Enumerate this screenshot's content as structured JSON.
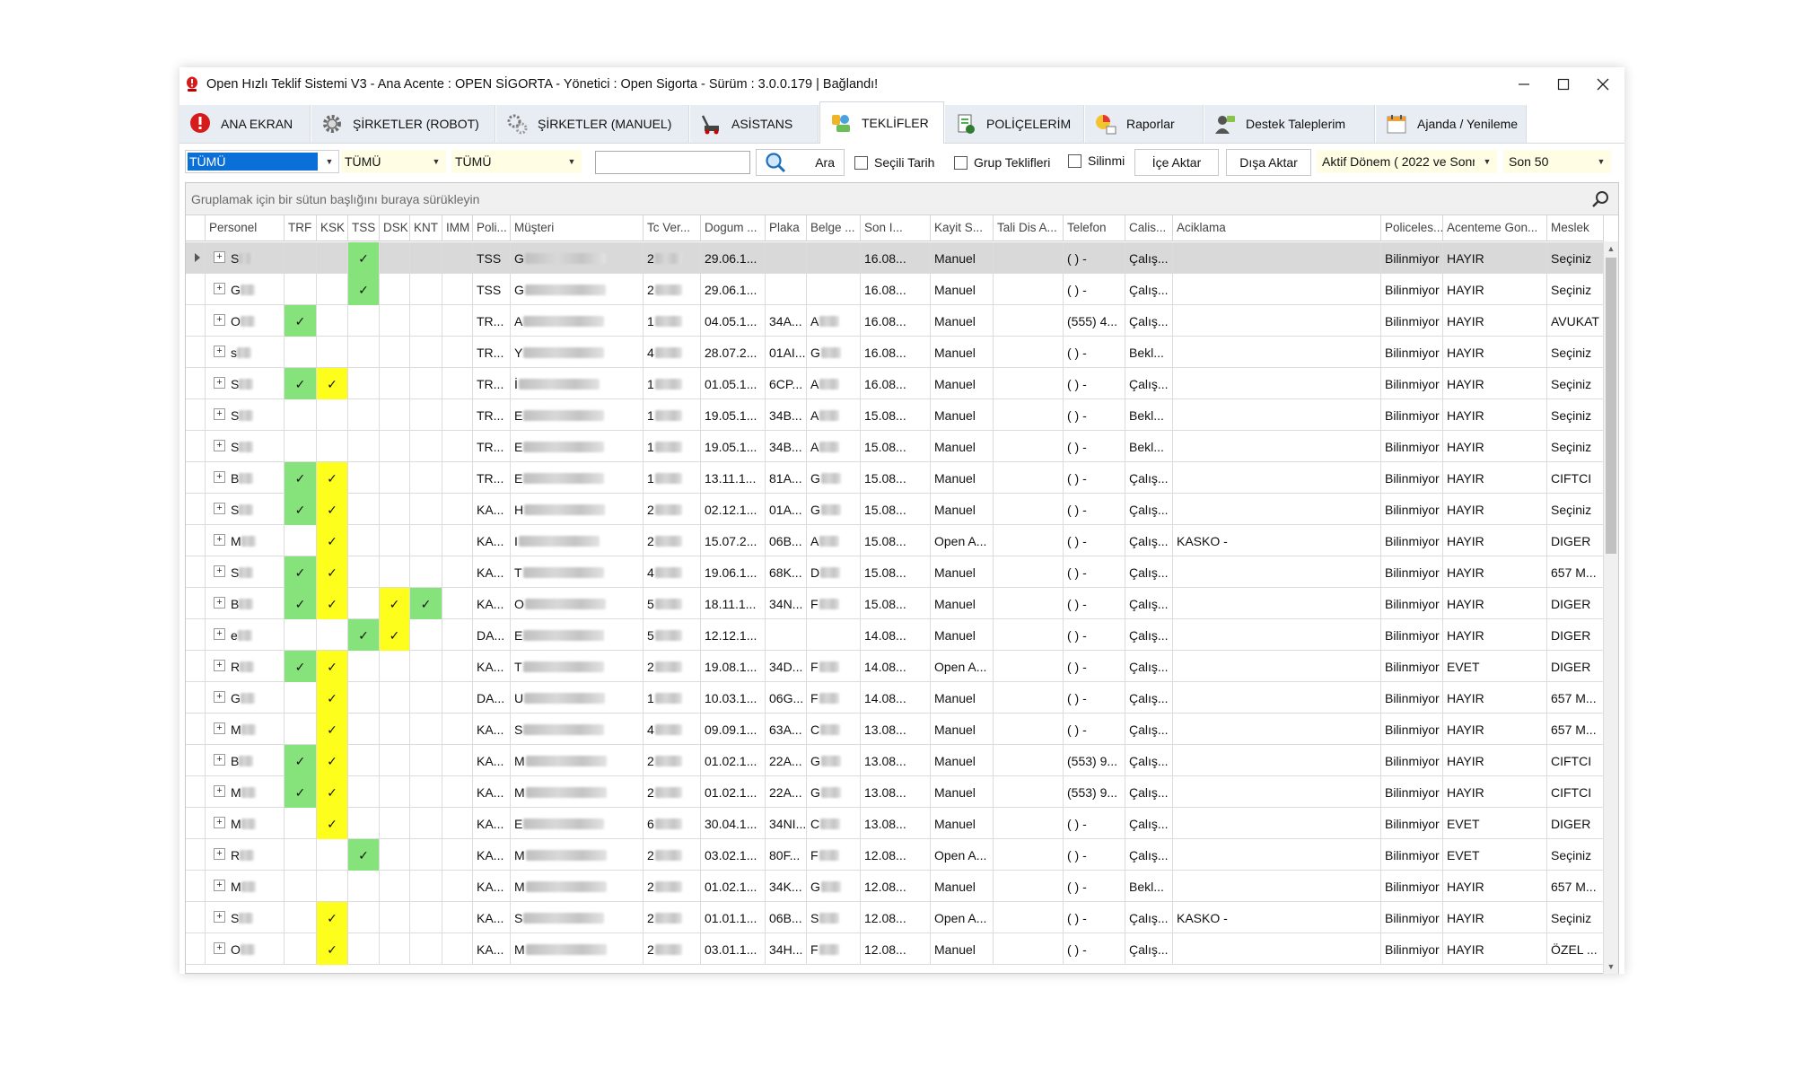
{
  "window": {
    "title": "Open Hızlı Teklif Sistemi V3 - Ana Acente : OPEN SİGORTA - Yönetici : Open Sigorta - Sürüm : 3.0.0.179 | Bağlandı!"
  },
  "tabs": [
    {
      "label": "ANA EKRAN",
      "icon": "home-alert-icon"
    },
    {
      "label": "ŞİRKETLER (ROBOT)",
      "icon": "gear-icon"
    },
    {
      "label": "ŞİRKETLER (MANUEL)",
      "icon": "gears-icon"
    },
    {
      "label": "ASİSTANS",
      "icon": "tow-truck-icon"
    },
    {
      "label": "TEKLİFLER",
      "icon": "offers-icon"
    },
    {
      "label": "POLİÇELERİM",
      "icon": "policy-icon"
    },
    {
      "label": "Raporlar",
      "icon": "reports-icon"
    },
    {
      "label": "Destek Taleplerim",
      "icon": "support-icon"
    },
    {
      "label": "Ajanda / Yenileme",
      "icon": "calendar-icon"
    }
  ],
  "active_tab": "TEKLİFLER",
  "toolbar": {
    "filter1": "TÜMÜ",
    "filter2": "TÜMÜ",
    "filter3": "TÜMÜ",
    "search_value": "",
    "search_button": "Ara",
    "checkbox_secili_tarih": "Seçili Tarih",
    "checkbox_grup_teklifleri": "Grup Teklifleri",
    "checkbox_silinmis": "Silinmi",
    "import_button": "İçe Aktar",
    "export_button": "Dışa Aktar",
    "period": "Aktif Dönem ( 2022 ve Sonr",
    "limit": "Son  50"
  },
  "grid": {
    "group_hint": "Gruplamak için bir sütun başlığını buraya sürükleyin",
    "columns": [
      "Personel",
      "TRF",
      "KSK",
      "TSS",
      "DSK",
      "KNT",
      "IMM",
      "Poli...",
      "Müşteri",
      "Tc Ver...",
      "Dogum ...",
      "Plaka",
      "Belge ...",
      "Son I...",
      "Kayit S...",
      "Tali Dis A...",
      "Telefon",
      "Calis...",
      "Aciklama",
      "Policeles...",
      "Acenteme Gon...",
      "Meslek"
    ],
    "rows": [
      {
        "p": "Sı",
        "trf": "",
        "ksk": "",
        "tss": "g",
        "dsk": "",
        "knt": "",
        "poli": "TSS",
        "m": "G",
        "tc": "2",
        "dog": "29.06.1...",
        "plaka": "",
        "belge": "",
        "son": "16.08...",
        "kayit": "Manuel",
        "tel": "( )  -",
        "calis": "Çalış...",
        "acik": "",
        "pol": "Bilinmiyor",
        "gon": "HAYIR",
        "meslek": "Seçiniz"
      },
      {
        "p": "Gı",
        "trf": "",
        "ksk": "",
        "tss": "g",
        "dsk": "",
        "knt": "",
        "poli": "TSS",
        "m": "G",
        "tc": "2",
        "dog": "29.06.1...",
        "plaka": "",
        "belge": "",
        "son": "16.08...",
        "kayit": "Manuel",
        "tel": "( )  -",
        "calis": "Çalış...",
        "acik": "",
        "pol": "Bilinmiyor",
        "gon": "HAYIR",
        "meslek": "Seçiniz"
      },
      {
        "p": "Oı",
        "trf": "g",
        "ksk": "",
        "tss": "",
        "dsk": "",
        "knt": "",
        "poli": "TR...",
        "m": "A",
        "tc": "1",
        "dog": "04.05.1...",
        "plaka": "34A...",
        "belge": "A",
        "son": "16.08...",
        "kayit": "Manuel",
        "tel": "(555) 4...",
        "calis": "Çalış...",
        "acik": "",
        "pol": "Bilinmiyor",
        "gon": "HAYIR",
        "meslek": "AVUKAT"
      },
      {
        "p": "sı",
        "trf": "",
        "ksk": "",
        "tss": "",
        "dsk": "",
        "knt": "",
        "poli": "TR...",
        "m": "Y",
        "tc": "4",
        "dog": "28.07.2...",
        "plaka": "01AI...",
        "belge": "G",
        "son": "16.08...",
        "kayit": "Manuel",
        "tel": "( )  -",
        "calis": "Bekl...",
        "acik": "",
        "pol": "Bilinmiyor",
        "gon": "HAYIR",
        "meslek": "Seçiniz"
      },
      {
        "p": "Sı",
        "trf": "g",
        "ksk": "y",
        "tss": "",
        "dsk": "",
        "knt": "",
        "poli": "TR...",
        "m": "İ",
        "tc": "1",
        "dog": "01.05.1...",
        "plaka": "6CP...",
        "belge": "A",
        "son": "16.08...",
        "kayit": "Manuel",
        "tel": "( )  -",
        "calis": "Çalış...",
        "acik": "",
        "pol": "Bilinmiyor",
        "gon": "HAYIR",
        "meslek": "Seçiniz"
      },
      {
        "p": "Sı",
        "trf": "",
        "ksk": "",
        "tss": "",
        "dsk": "",
        "knt": "",
        "poli": "TR...",
        "m": "E",
        "tc": "1",
        "dog": "19.05.1...",
        "plaka": "34B...",
        "belge": "A",
        "son": "15.08...",
        "kayit": "Manuel",
        "tel": "( )  -",
        "calis": "Bekl...",
        "acik": "",
        "pol": "Bilinmiyor",
        "gon": "HAYIR",
        "meslek": "Seçiniz"
      },
      {
        "p": "Sı",
        "trf": "",
        "ksk": "",
        "tss": "",
        "dsk": "",
        "knt": "",
        "poli": "TR...",
        "m": "E",
        "tc": "1",
        "dog": "19.05.1...",
        "plaka": "34B...",
        "belge": "A",
        "son": "15.08...",
        "kayit": "Manuel",
        "tel": "( )  -",
        "calis": "Bekl...",
        "acik": "",
        "pol": "Bilinmiyor",
        "gon": "HAYIR",
        "meslek": "Seçiniz"
      },
      {
        "p": "Bı",
        "trf": "g",
        "ksk": "y",
        "tss": "",
        "dsk": "",
        "knt": "",
        "poli": "TR...",
        "m": "E",
        "tc": "1",
        "dog": "13.11.1...",
        "plaka": "81A...",
        "belge": "G",
        "son": "15.08...",
        "kayit": "Manuel",
        "tel": "( )  -",
        "calis": "Çalış...",
        "acik": "",
        "pol": "Bilinmiyor",
        "gon": "HAYIR",
        "meslek": "CIFTCI"
      },
      {
        "p": "Sı",
        "trf": "g",
        "ksk": "y",
        "tss": "",
        "dsk": "",
        "knt": "",
        "poli": "KA...",
        "m": "H",
        "tc": "2",
        "dog": "02.12.1...",
        "plaka": "01A...",
        "belge": "G",
        "son": "15.08...",
        "kayit": "Manuel",
        "tel": "( )  -",
        "calis": "Çalış...",
        "acik": "",
        "pol": "Bilinmiyor",
        "gon": "HAYIR",
        "meslek": "Seçiniz"
      },
      {
        "p": "Mı",
        "trf": "",
        "ksk": "y",
        "tss": "",
        "dsk": "",
        "knt": "",
        "poli": "KA...",
        "m": "I",
        "tc": "2",
        "dog": "15.07.2...",
        "plaka": "06B...",
        "belge": "A",
        "son": "15.08...",
        "kayit": "Open A...",
        "tel": "( )  -",
        "calis": "Çalış...",
        "acik": "KASKO -",
        "pol": "Bilinmiyor",
        "gon": "HAYIR",
        "meslek": "DIGER"
      },
      {
        "p": "Sı",
        "trf": "g",
        "ksk": "y",
        "tss": "",
        "dsk": "",
        "knt": "",
        "poli": "KA...",
        "m": "T",
        "tc": "4",
        "dog": "19.06.1...",
        "plaka": "68K...",
        "belge": "D",
        "son": "15.08...",
        "kayit": "Manuel",
        "tel": "( )  -",
        "calis": "Çalış...",
        "acik": "",
        "pol": "Bilinmiyor",
        "gon": "HAYIR",
        "meslek": "657 M..."
      },
      {
        "p": "Bı",
        "trf": "g",
        "ksk": "y",
        "tss": "",
        "dsk": "y",
        "knt": "g",
        "poli": "KA...",
        "m": "O",
        "tc": "5",
        "dog": "18.11.1...",
        "plaka": "34N...",
        "belge": "F",
        "son": "15.08...",
        "kayit": "Manuel",
        "tel": "( )  -",
        "calis": "Çalış...",
        "acik": "",
        "pol": "Bilinmiyor",
        "gon": "HAYIR",
        "meslek": "DIGER"
      },
      {
        "p": "er",
        "trf": "",
        "ksk": "",
        "tss": "g",
        "dsk": "y",
        "knt": "",
        "poli": "DA...",
        "m": "E",
        "tc": "5",
        "dog": "12.12.1...",
        "plaka": "",
        "belge": "",
        "son": "14.08...",
        "kayit": "Manuel",
        "tel": "( )  -",
        "calis": "Çalış...",
        "acik": "",
        "pol": "Bilinmiyor",
        "gon": "HAYIR",
        "meslek": "DIGER"
      },
      {
        "p": "Rı",
        "trf": "g",
        "ksk": "y",
        "tss": "",
        "dsk": "",
        "knt": "",
        "poli": "KA...",
        "m": "T",
        "tc": "2",
        "dog": "19.08.1...",
        "plaka": "34D...",
        "belge": "F",
        "son": "14.08...",
        "kayit": "Open A...",
        "tel": "( )  -",
        "calis": "Çalış...",
        "acik": "",
        "pol": "Bilinmiyor",
        "gon": "EVET",
        "meslek": "DIGER"
      },
      {
        "p": "Gı",
        "trf": "",
        "ksk": "y",
        "tss": "",
        "dsk": "",
        "knt": "",
        "poli": "DA...",
        "m": "U",
        "tc": "1",
        "dog": "10.03.1...",
        "plaka": "06G...",
        "belge": "F",
        "son": "14.08...",
        "kayit": "Manuel",
        "tel": "( )  -",
        "calis": "Çalış...",
        "acik": "",
        "pol": "Bilinmiyor",
        "gon": "HAYIR",
        "meslek": "657 M..."
      },
      {
        "p": "M",
        "trf": "",
        "ksk": "y",
        "tss": "",
        "dsk": "",
        "knt": "",
        "poli": "KA...",
        "m": "S",
        "tc": "4",
        "dog": "09.09.1...",
        "plaka": "63A...",
        "belge": "C",
        "son": "13.08...",
        "kayit": "Manuel",
        "tel": "( )  -",
        "calis": "Çalış...",
        "acik": "",
        "pol": "Bilinmiyor",
        "gon": "HAYIR",
        "meslek": "657 M..."
      },
      {
        "p": "Bı",
        "trf": "g",
        "ksk": "y",
        "tss": "",
        "dsk": "",
        "knt": "",
        "poli": "KA...",
        "m": "M",
        "tc": "2",
        "dog": "01.02.1...",
        "plaka": "22A...",
        "belge": "G",
        "son": "13.08...",
        "kayit": "Manuel",
        "tel": "(553) 9...",
        "calis": "Çalış...",
        "acik": "",
        "pol": "Bilinmiyor",
        "gon": "HAYIR",
        "meslek": "CIFTCI"
      },
      {
        "p": "M",
        "trf": "g",
        "ksk": "y",
        "tss": "",
        "dsk": "",
        "knt": "",
        "poli": "KA...",
        "m": "M",
        "tc": "2",
        "dog": "01.02.1...",
        "plaka": "22A...",
        "belge": "G",
        "son": "13.08...",
        "kayit": "Manuel",
        "tel": "(553) 9...",
        "calis": "Çalış...",
        "acik": "",
        "pol": "Bilinmiyor",
        "gon": "HAYIR",
        "meslek": "CIFTCI"
      },
      {
        "p": "Mı",
        "trf": "",
        "ksk": "y",
        "tss": "",
        "dsk": "",
        "knt": "",
        "poli": "KA...",
        "m": "E",
        "tc": "6",
        "dog": "30.04.1...",
        "plaka": "34NI...",
        "belge": "C",
        "son": "13.08...",
        "kayit": "Manuel",
        "tel": "( )  -",
        "calis": "Çalış...",
        "acik": "",
        "pol": "Bilinmiyor",
        "gon": "EVET",
        "meslek": "DIGER"
      },
      {
        "p": "Rı",
        "trf": "",
        "ksk": "",
        "tss": "g",
        "dsk": "",
        "knt": "",
        "poli": "KA...",
        "m": "M",
        "tc": "2",
        "dog": "03.02.1...",
        "plaka": "80F...",
        "belge": "F",
        "son": "12.08...",
        "kayit": "Open A...",
        "tel": "( )  -",
        "calis": "Çalış...",
        "acik": "",
        "pol": "Bilinmiyor",
        "gon": "EVET",
        "meslek": "Seçiniz"
      },
      {
        "p": "M",
        "trf": "",
        "ksk": "",
        "tss": "",
        "dsk": "",
        "knt": "",
        "poli": "KA...",
        "m": "M",
        "tc": "2",
        "dog": "01.02.1...",
        "plaka": "34K...",
        "belge": "G",
        "son": "12.08...",
        "kayit": "Manuel",
        "tel": "( )  -",
        "calis": "Bekl...",
        "acik": "",
        "pol": "Bilinmiyor",
        "gon": "HAYIR",
        "meslek": "657 M..."
      },
      {
        "p": "Sı",
        "trf": "",
        "ksk": "y",
        "tss": "",
        "dsk": "",
        "knt": "",
        "poli": "KA...",
        "m": "S",
        "tc": "2",
        "dog": "01.01.1...",
        "plaka": "06B...",
        "belge": "S",
        "son": "12.08...",
        "kayit": "Open A...",
        "tel": "( )  -",
        "calis": "Çalış...",
        "acik": "KASKO -",
        "pol": "Bilinmiyor",
        "gon": "HAYIR",
        "meslek": "Seçiniz"
      },
      {
        "p": "Oı",
        "trf": "",
        "ksk": "y",
        "tss": "",
        "dsk": "",
        "knt": "",
        "poli": "KA...",
        "m": "M",
        "tc": "2",
        "dog": "03.01.1...",
        "plaka": "34H...",
        "belge": "F",
        "son": "12.08...",
        "kayit": "Manuel",
        "tel": "( )  -",
        "calis": "Çalış...",
        "acik": "",
        "pol": "Bilinmiyor",
        "gon": "HAYIR",
        "meslek": "ÖZEL ..."
      }
    ]
  },
  "colors": {
    "tick_green": "#86e27a",
    "tick_yellow": "#fefe1c",
    "selection_blue": "#0a70d8"
  }
}
